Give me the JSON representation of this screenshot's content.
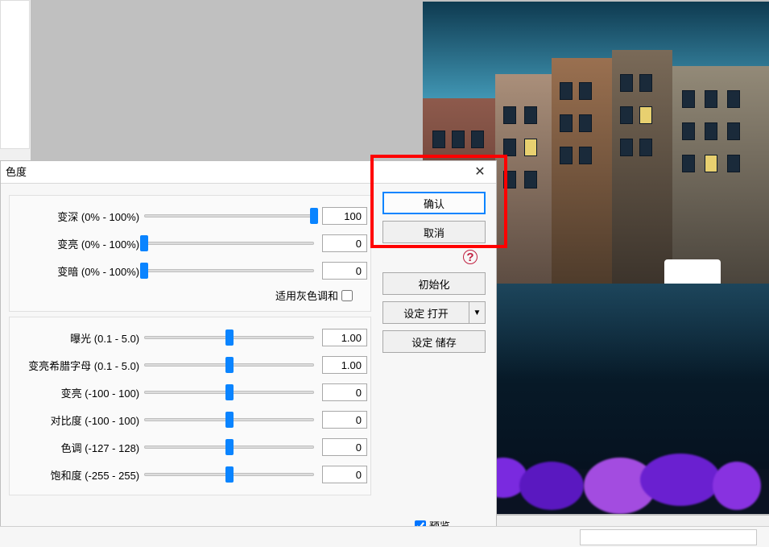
{
  "dialog": {
    "title": "色度",
    "close_glyph": "✕",
    "group1": {
      "sliders": [
        {
          "label": "变深 (0% - 100%)",
          "value": "100",
          "pos": 100
        },
        {
          "label": "变亮 (0% - 100%)",
          "value": "0",
          "pos": 0
        },
        {
          "label": "变暗 (0% - 100%)",
          "value": "0",
          "pos": 0
        }
      ],
      "gray_label": "适用灰色调和",
      "gray_checked": false
    },
    "group2": {
      "sliders": [
        {
          "label": "曝光 (0.1 - 5.0)",
          "value": "1.00",
          "pos": 50
        },
        {
          "label": "变亮希腊字母 (0.1 - 5.0)",
          "value": "1.00",
          "pos": 50
        },
        {
          "label": "变亮 (-100 - 100)",
          "value": "0",
          "pos": 50
        },
        {
          "label": "对比度 (-100 - 100)",
          "value": "0",
          "pos": 50
        },
        {
          "label": "色调 (-127 - 128)",
          "value": "0",
          "pos": 50
        },
        {
          "label": "饱和度 (-255 - 255)",
          "value": "0",
          "pos": 50
        }
      ]
    },
    "buttons": {
      "ok": "确认",
      "cancel": "取消",
      "init": "初始化",
      "open": "设定 打开",
      "open_drop": "▼",
      "save": "设定 储存"
    },
    "help_glyph": "?",
    "preview_label": "预览",
    "preview_checked": true
  }
}
